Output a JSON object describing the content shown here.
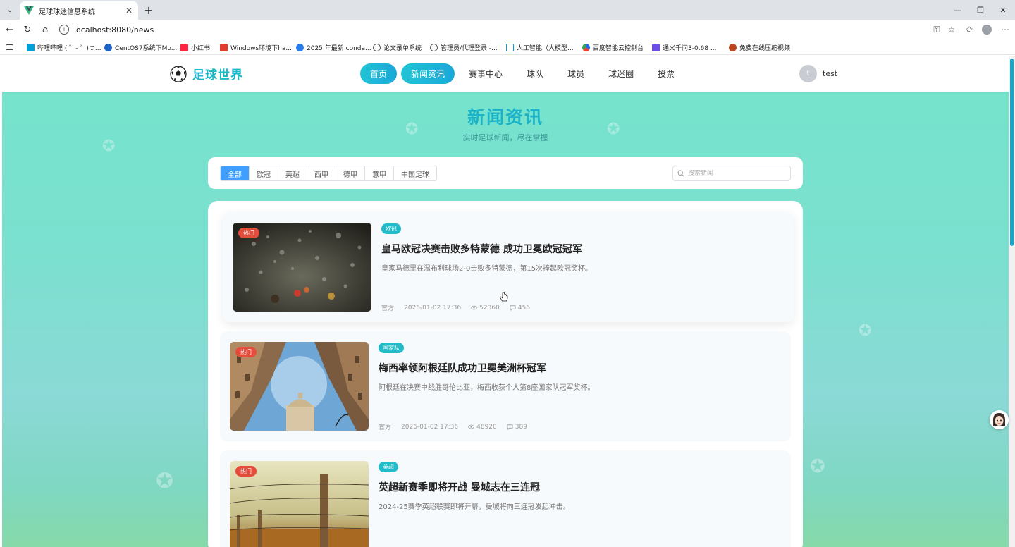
{
  "browser": {
    "tab_title": "足球球迷信息系统",
    "url": "localhost:8080/news",
    "bookmarks": [
      {
        "label": "哔哩哔哩 ( ゜- ゜)つ...",
        "color": "#00a1d6"
      },
      {
        "label": "CentOS7系统下Mo...",
        "color": "#1e63c8"
      },
      {
        "label": "小红书",
        "color": "#ff2442"
      },
      {
        "label": "Windows环境下ha...",
        "color": "#e23c2f"
      },
      {
        "label": "2025 年最新 conda...",
        "color": "#2b7de9"
      },
      {
        "label": "论文录单系统",
        "color": "#666666"
      },
      {
        "label": "管理员/代理登录 -...",
        "color": "#666666"
      },
      {
        "label": "人工智能（大模型...",
        "color": "#00a1d6"
      },
      {
        "label": "百度智能云控制台",
        "color": "#2468f2"
      },
      {
        "label": "通义千问3-0.68 ...",
        "color": "#6c4ce7"
      },
      {
        "label": "免费在线压缩视频",
        "color": "#b8431f"
      }
    ]
  },
  "header": {
    "logo_text": "足球世界",
    "nav": [
      {
        "label": "首页",
        "active": true
      },
      {
        "label": "新闻资讯",
        "active": true
      },
      {
        "label": "赛事中心",
        "active": false
      },
      {
        "label": "球队",
        "active": false
      },
      {
        "label": "球员",
        "active": false
      },
      {
        "label": "球迷圈",
        "active": false
      },
      {
        "label": "投票",
        "active": false
      }
    ],
    "avatar_initial": "t",
    "username": "test"
  },
  "page": {
    "title": "新闻资讯",
    "subtitle": "实时足球新闻，尽在掌握"
  },
  "filters": {
    "categories": [
      "全部",
      "欧冠",
      "英超",
      "西甲",
      "德甲",
      "意甲",
      "中国足球"
    ],
    "selected": "全部",
    "search_placeholder": "搜索新闻",
    "search_value": ""
  },
  "news": [
    {
      "badge": "热门",
      "category": "欧冠",
      "title": "皇马欧冠决赛击败多特蒙德 成功卫冕欧冠冠军",
      "summary": "皇家马德里在温布利球场2-0击败多特蒙德，第15次捧起欧冠奖杯。",
      "source": "官方",
      "time": "2026-01-02 17:36",
      "views": "52360",
      "comments": "456"
    },
    {
      "badge": "热门",
      "category": "国家队",
      "title": "梅西率领阿根廷队成功卫冕美洲杯冠军",
      "summary": "阿根廷在决赛中战胜哥伦比亚，梅西收获个人第8座国家队冠军奖杯。",
      "source": "官方",
      "time": "2026-01-02 17:36",
      "views": "48920",
      "comments": "389"
    },
    {
      "badge": "热门",
      "category": "英超",
      "title": "英超新赛季即将开战 曼城志在三连冠",
      "summary": "2024-25赛季英超联赛即将开幕，曼城将向三连冠发起冲击。",
      "source": "",
      "time": "",
      "views": "",
      "comments": ""
    }
  ],
  "colors": {
    "accent": "#1bb8c9",
    "hot_badge": "#e44d3c",
    "filter_active": "#409eff"
  }
}
